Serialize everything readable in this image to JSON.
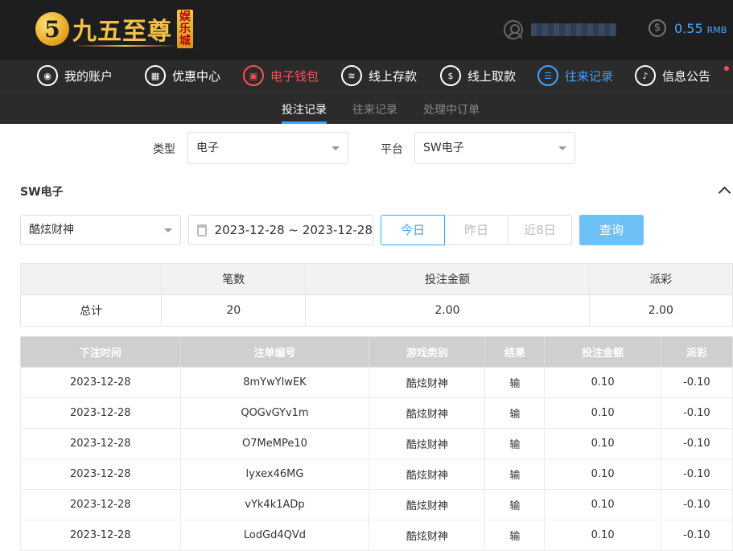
{
  "brand": {
    "badge": "5",
    "name": "九五至尊",
    "tag": "娱乐城"
  },
  "account": {
    "balance": "0.55",
    "currency": "RMB"
  },
  "nav": [
    {
      "label": "我的账户",
      "icon": "user-icon"
    },
    {
      "label": "优惠中心",
      "icon": "gift-icon"
    },
    {
      "label": "电子钱包",
      "icon": "wallet-icon"
    },
    {
      "label": "线上存款",
      "icon": "deposit-icon"
    },
    {
      "label": "线上取款",
      "icon": "withdraw-icon"
    },
    {
      "label": "往来记录",
      "icon": "records-icon"
    },
    {
      "label": "信息公告",
      "icon": "bell-icon"
    }
  ],
  "subnav": [
    {
      "label": "投注记录"
    },
    {
      "label": "往来记录"
    },
    {
      "label": "处理中订单"
    }
  ],
  "filters": {
    "type_label": "类型",
    "type_value": "电子",
    "platform_label": "平台",
    "platform_value": "SW电子"
  },
  "section": {
    "title": "SW电子"
  },
  "query": {
    "game_value": "酷炫财神",
    "date_range": "2023-12-28 ~ 2023-12-28",
    "today": "今日",
    "yesterday": "昨日",
    "last8": "近8日",
    "submit": "查询"
  },
  "summary": {
    "headers": [
      "",
      "笔数",
      "投注金额",
      "派彩"
    ],
    "row": [
      "总计",
      "20",
      "2.00",
      "2.00"
    ]
  },
  "records": {
    "headers": [
      "下注时间",
      "注单编号",
      "游戏类别",
      "结果",
      "投注金额",
      "派彩"
    ],
    "rows": [
      [
        "2023-12-28",
        "8mYwYlwEK",
        "酷炫财神",
        "输",
        "0.10",
        "-0.10"
      ],
      [
        "2023-12-28",
        "QOGvGYv1m",
        "酷炫财神",
        "输",
        "0.10",
        "-0.10"
      ],
      [
        "2023-12-28",
        "O7MeMPe10",
        "酷炫财神",
        "输",
        "0.10",
        "-0.10"
      ],
      [
        "2023-12-28",
        "lyxex46MG",
        "酷炫财神",
        "输",
        "0.10",
        "-0.10"
      ],
      [
        "2023-12-28",
        "vYk4k1ADp",
        "酷炫财神",
        "输",
        "0.10",
        "-0.10"
      ],
      [
        "2023-12-28",
        "LodGd4QVd",
        "酷炫财神",
        "输",
        "0.10",
        "-0.10"
      ]
    ]
  },
  "colors": {
    "accent": "#3fa3ff",
    "active_nav": "#ff4d5a",
    "negative": "#e4393c",
    "header_bg": "#1e1e1e"
  }
}
